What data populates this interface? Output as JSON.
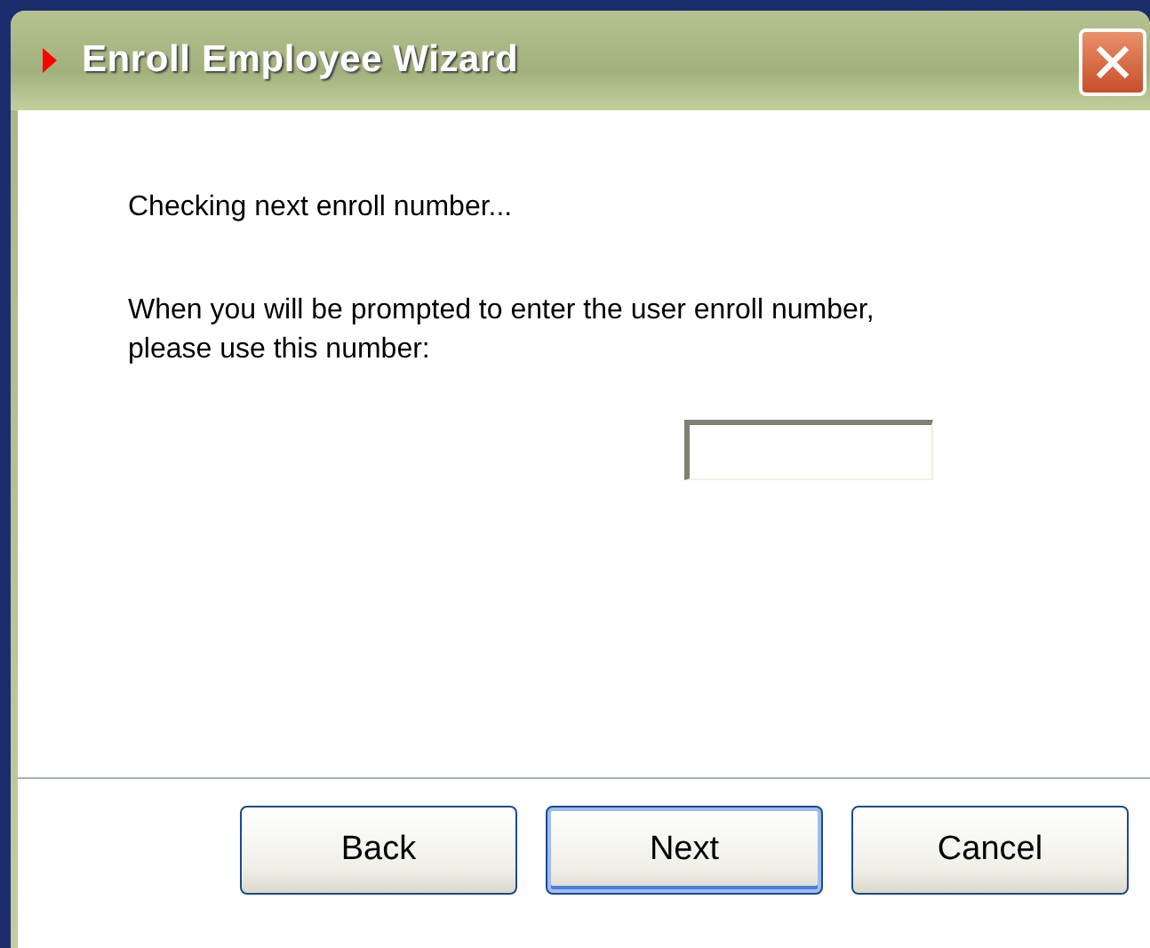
{
  "window": {
    "title": "Enroll Employee Wizard"
  },
  "status_text": "Checking next enroll number...",
  "instruction": "When you will be prompted to enter the user enroll number, please use this number:",
  "buttons": [
    {
      "label": "Back",
      "default": false
    },
    {
      "label": "Next",
      "default": true
    },
    {
      "label": "Cancel",
      "default": false
    }
  ]
}
